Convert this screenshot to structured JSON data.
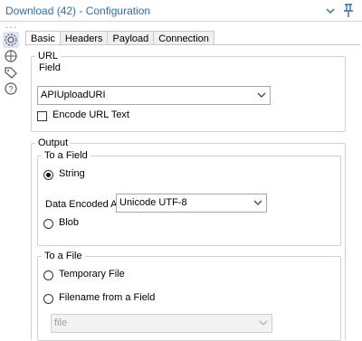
{
  "window": {
    "title": "Download (42) - Configuration"
  },
  "tabs": [
    {
      "label": "Basic",
      "active": true
    },
    {
      "label": "Headers",
      "active": false
    },
    {
      "label": "Payload",
      "active": false
    },
    {
      "label": "Connection",
      "active": false
    }
  ],
  "url_group": {
    "legend": "URL",
    "field_label": "Field",
    "field_value": "APIUploadURI",
    "encode_label": "Encode URL Text",
    "encode_checked": false
  },
  "output_group": {
    "legend": "Output",
    "to_field": {
      "legend": "To a Field",
      "string_label": "String",
      "string_selected": true,
      "encoding_label": "Data Encoded As",
      "encoding_value": "Unicode UTF-8",
      "blob_label": "Blob",
      "blob_selected": false
    },
    "to_file": {
      "legend": "To a File",
      "temp_label": "Temporary File",
      "filename_label": "Filename from a Field",
      "file_select_value": "file",
      "file_select_disabled": true
    }
  },
  "colors": {
    "title_blue": "#2a6fb0"
  },
  "icons": [
    "chevron-down-icon",
    "pin-icon",
    "gear-icon",
    "globe-icon",
    "tag-icon",
    "help-icon"
  ]
}
